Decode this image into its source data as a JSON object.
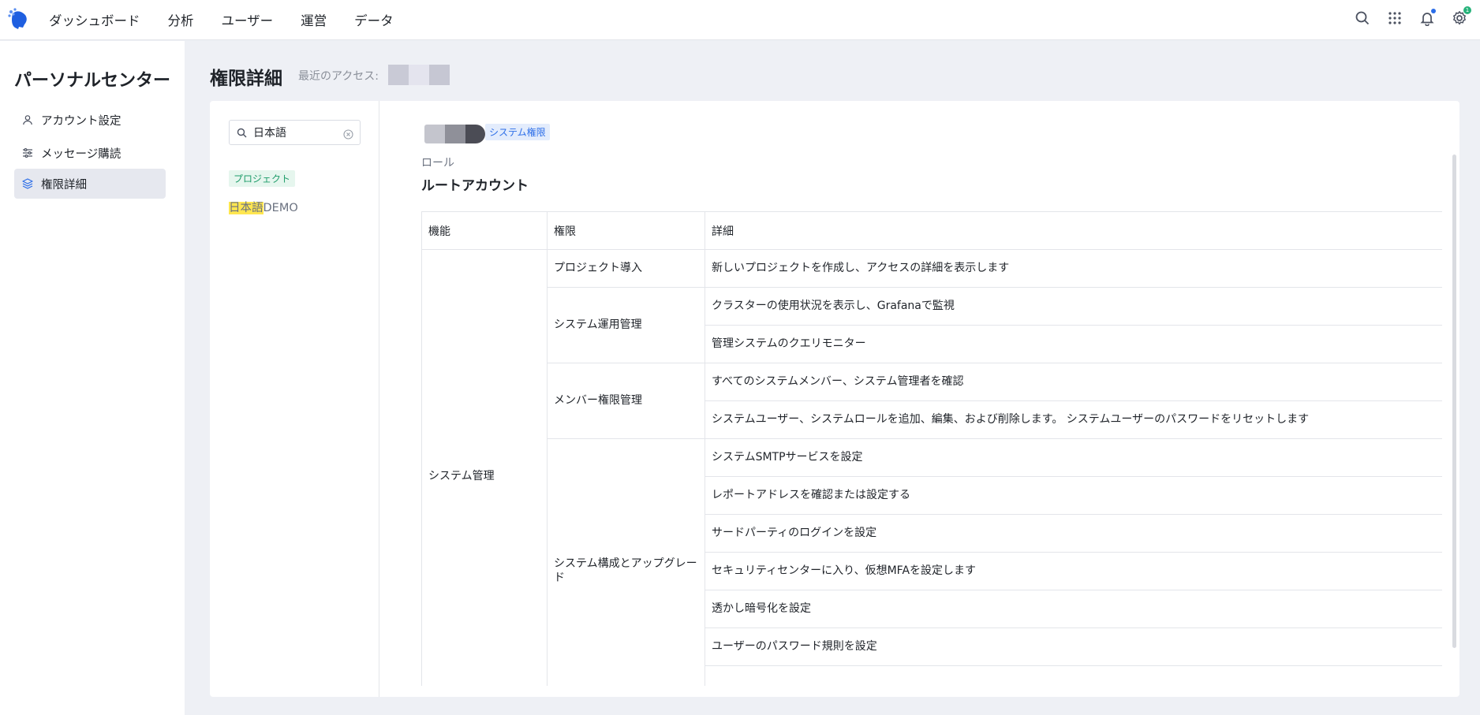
{
  "nav": {
    "items": [
      "ダッシュボード",
      "分析",
      "ユーザー",
      "運営",
      "データ"
    ],
    "notification_count": "1"
  },
  "icons": {
    "logo": "brain-logo-icon",
    "search": "search-icon",
    "apps": "grid-icon",
    "notifications": "bell-icon",
    "settings": "gear-icon"
  },
  "sidebar": {
    "title": "パーソナルセンター",
    "items": [
      {
        "label": "アカウント設定",
        "icon": "user-icon",
        "active": false
      },
      {
        "label": "メッセージ購読",
        "icon": "sliders-icon",
        "active": false
      },
      {
        "label": "権限詳細",
        "icon": "layers-icon",
        "active": true
      }
    ]
  },
  "main": {
    "title": "権限詳細",
    "recent_label": "最近のアクセス:"
  },
  "search": {
    "value": "日本語"
  },
  "projects": {
    "tag": "プロジェクト",
    "items": [
      {
        "highlight": "日本語",
        "rest": "DEMO"
      }
    ]
  },
  "detail": {
    "system_tag": "システム権限",
    "role_label": "ロール",
    "role_value": "ルートアカウント",
    "table": {
      "headers": [
        "機能",
        "権限",
        "詳細"
      ],
      "function": "システム管理",
      "groups": [
        {
          "permission": "プロジェクト導入",
          "details": [
            "新しいプロジェクトを作成し、アクセスの詳細を表示します"
          ]
        },
        {
          "permission": "システム運用管理",
          "details": [
            "クラスターの使用状況を表示し、Grafanaで監視",
            "管理システムのクエリモニター"
          ]
        },
        {
          "permission": "メンバー権限管理",
          "details": [
            "すべてのシステムメンバー、システム管理者を確認",
            "システムユーザー、システムロールを追加、編集、および削除します。 システムユーザーのパスワードをリセットします"
          ]
        },
        {
          "permission": "システム構成とアップグレード",
          "details": [
            "システムSMTPサービスを設定",
            "レポートアドレスを確認または設定する",
            "サードパーティのログインを設定",
            "セキュリティセンターに入り、仮想MFAを設定します",
            "透かし暗号化を設定",
            "ユーザーのパスワード規則を設定"
          ]
        }
      ]
    }
  },
  "colors": {
    "accent": "#2b6de8",
    "highlight": "#ffe650",
    "project_tag": "#1f9c6a"
  }
}
